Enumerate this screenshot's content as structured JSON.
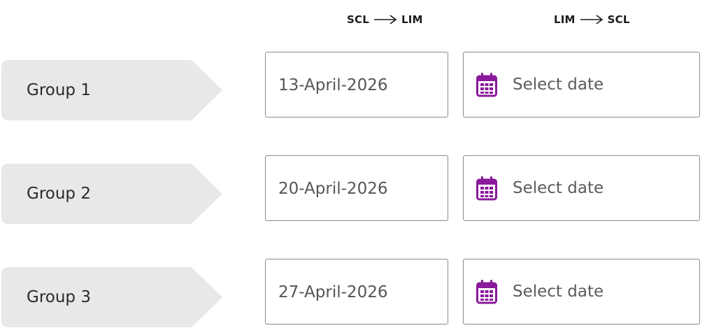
{
  "columns": {
    "outbound": {
      "from": "SCL",
      "to": "LIM"
    },
    "return": {
      "from": "LIM",
      "to": "SCL"
    }
  },
  "groups": [
    {
      "label": "Group 1",
      "outbound_date": "13-April-2026",
      "return_placeholder": "Select date"
    },
    {
      "label": "Group 2",
      "outbound_date": "20-April-2026",
      "return_placeholder": "Select date"
    },
    {
      "label": "Group 3",
      "outbound_date": "27-April-2026",
      "return_placeholder": "Select date"
    }
  ],
  "colors": {
    "accent": "#8a1a9b",
    "tag_background": "#e8e8e8",
    "field_border": "#8a8a8a"
  },
  "icons": {
    "calendar": "calendar-icon",
    "arrow": "arrow-right-icon"
  }
}
